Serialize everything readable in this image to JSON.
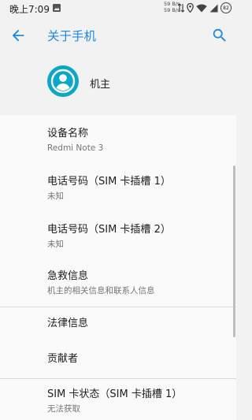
{
  "status_bar": {
    "time": "晚上7:09",
    "speed_up": "59 B/s",
    "speed_down": "59 B/s",
    "battery": "82"
  },
  "app_bar": {
    "title": "关于手机"
  },
  "profile": {
    "label": "机主"
  },
  "items": [
    {
      "title": "设备名称",
      "subtitle": "Redmi Note 3"
    },
    {
      "title": "电话号码（SIM 卡插槽 1）",
      "subtitle": "未知"
    },
    {
      "title": "电话号码（SIM 卡插槽 2）",
      "subtitle": "未知"
    },
    {
      "title": "急救信息",
      "subtitle": "机主的相关信息和联系人信息"
    },
    {
      "title": "法律信息"
    },
    {
      "title": "贡献者"
    },
    {
      "title": "SIM 卡状态（SIM 卡插槽 1）",
      "subtitle": "无法获取"
    }
  ],
  "colors": {
    "accent": "#1e88e5",
    "avatar": "#0aa7c9"
  }
}
